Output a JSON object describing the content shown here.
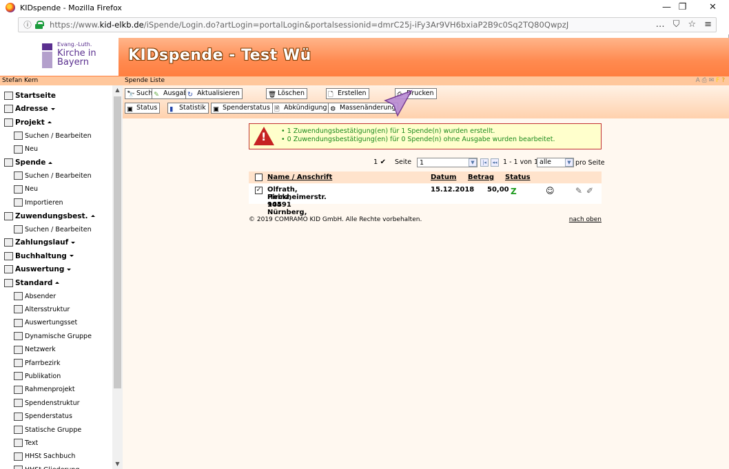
{
  "window": {
    "title": "KIDspende - Mozilla Firefox",
    "controls": [
      "—",
      "❐",
      "✕"
    ]
  },
  "browser": {
    "url_prefix": "https://www.",
    "url_domain": "kid-elkb.de",
    "url_rest": "/iSpende/Login.do?artLogin=portalLogin&portalsessionid=dmrC25j-iFy3Ar9VH6bxiaP2B9c0Sq2TQ80QwpzJ",
    "icons": [
      "…",
      "⛉",
      "☆",
      "≡"
    ]
  },
  "header": {
    "logo_line1": "Evang.-Luth.",
    "logo_line2": "Kirche in",
    "logo_line3": "Bayern",
    "app_title": "KIDspende - Test Wü"
  },
  "sidebar": {
    "user": "Stefan Kern",
    "items": [
      {
        "label": "Startseite",
        "level": "top",
        "icon": "home-icon"
      },
      {
        "label": "Adresse",
        "level": "top",
        "icon": "address-icon",
        "caret": "down"
      },
      {
        "label": "Projekt",
        "level": "top",
        "icon": "project-icon",
        "caret": "up"
      },
      {
        "label": "Suchen / Bearbeiten",
        "level": "sub",
        "icon": "binoculars-icon"
      },
      {
        "label": "Neu",
        "level": "sub",
        "icon": "new-document-icon"
      },
      {
        "label": "Spende",
        "level": "top",
        "icon": "donation-icon",
        "caret": "up"
      },
      {
        "label": "Suchen / Bearbeiten",
        "level": "sub",
        "icon": "binoculars-icon"
      },
      {
        "label": "Neu",
        "level": "sub",
        "icon": "new-document-icon"
      },
      {
        "label": "Importieren",
        "level": "sub",
        "icon": "import-icon"
      },
      {
        "label": "Zuwendungsbest.",
        "level": "top",
        "icon": "certificate-icon",
        "caret": "up"
      },
      {
        "label": "Suchen / Bearbeiten",
        "level": "sub",
        "icon": "binoculars-icon"
      },
      {
        "label": "Zahlungslauf",
        "level": "top",
        "icon": "payment-run-icon",
        "caret": "down"
      },
      {
        "label": "Buchhaltung",
        "level": "top",
        "icon": "accounting-icon",
        "caret": "down"
      },
      {
        "label": "Auswertung",
        "level": "top",
        "icon": "evaluation-icon",
        "caret": "down"
      },
      {
        "label": "Standard",
        "level": "top",
        "icon": "standard-icon",
        "caret": "up"
      },
      {
        "label": "Absender",
        "level": "sub",
        "icon": "sender-icon"
      },
      {
        "label": "Altersstruktur",
        "level": "sub",
        "icon": "age-structure-icon"
      },
      {
        "label": "Auswertungsset",
        "level": "sub",
        "icon": "evaluation-set-icon"
      },
      {
        "label": "Dynamische Gruppe",
        "level": "sub",
        "icon": "dynamic-group-icon"
      },
      {
        "label": "Netzwerk",
        "level": "sub",
        "icon": "network-icon"
      },
      {
        "label": "Pfarrbezirk",
        "level": "sub",
        "icon": "parish-icon"
      },
      {
        "label": "Publikation",
        "level": "sub",
        "icon": "publication-icon"
      },
      {
        "label": "Rahmenprojekt",
        "level": "sub",
        "icon": "framework-project-icon"
      },
      {
        "label": "Spendenstruktur",
        "level": "sub",
        "icon": "donation-structure-icon"
      },
      {
        "label": "Spenderstatus",
        "level": "sub",
        "icon": "donor-status-icon"
      },
      {
        "label": "Statische Gruppe",
        "level": "sub",
        "icon": "static-group-icon"
      },
      {
        "label": "Text",
        "level": "sub",
        "icon": "text-icon"
      },
      {
        "label": "HHSt Sachbuch",
        "level": "sub",
        "icon": "ledger-icon"
      },
      {
        "label": "HHSt Gliederung",
        "level": "sub",
        "icon": "structure-icon"
      }
    ]
  },
  "main": {
    "section_title": "Spende Liste",
    "toolbar_row1": [
      "Suchen",
      "Ausgabe",
      "Aktualisieren",
      "Löschen",
      "Erstellen",
      "Drucken"
    ],
    "toolbar_row2": [
      "Status",
      "Statistik",
      "Spenderstatus",
      "Abkündigung",
      "Massenänderung"
    ],
    "notice": [
      "1 Zuwendungsbestätigung(en) für 1 Spende(n) wurden erstellt.",
      "0 Zuwendungsbestätigung(en) für 0 Spende(n) ohne Ausgabe wurden bearbeitet."
    ],
    "pager": {
      "selected_count": "1",
      "page_label": "Seite",
      "page_value": "1",
      "range": "1 - 1 von 1",
      "per_page_value": "alle",
      "per_page_label": "pro Seite"
    },
    "table": {
      "headers": [
        "Name / Anschrift",
        "Datum",
        "Betrag",
        "Status"
      ],
      "rows": [
        {
          "name_line1": "Olfrath, Heinz, 90491 Nürnberg,",
          "name_line2": "Pirckheimerstr. 145",
          "date": "15.12.2018",
          "amount": "50,00",
          "status": "Z",
          "checked": true
        }
      ]
    },
    "footer_copyright": "© 2019 COMRAMO KID GmbH. Alle Rechte vorbehalten.",
    "footer_link": "nach oben"
  },
  "colors": {
    "header_orange": "#ff8a50",
    "strip_peach": "#ffc79c",
    "notice_bg": "#ffffcc",
    "notice_border": "#c23030",
    "notice_text": "#1c8a1c",
    "status_green": "#1c9a1c"
  }
}
